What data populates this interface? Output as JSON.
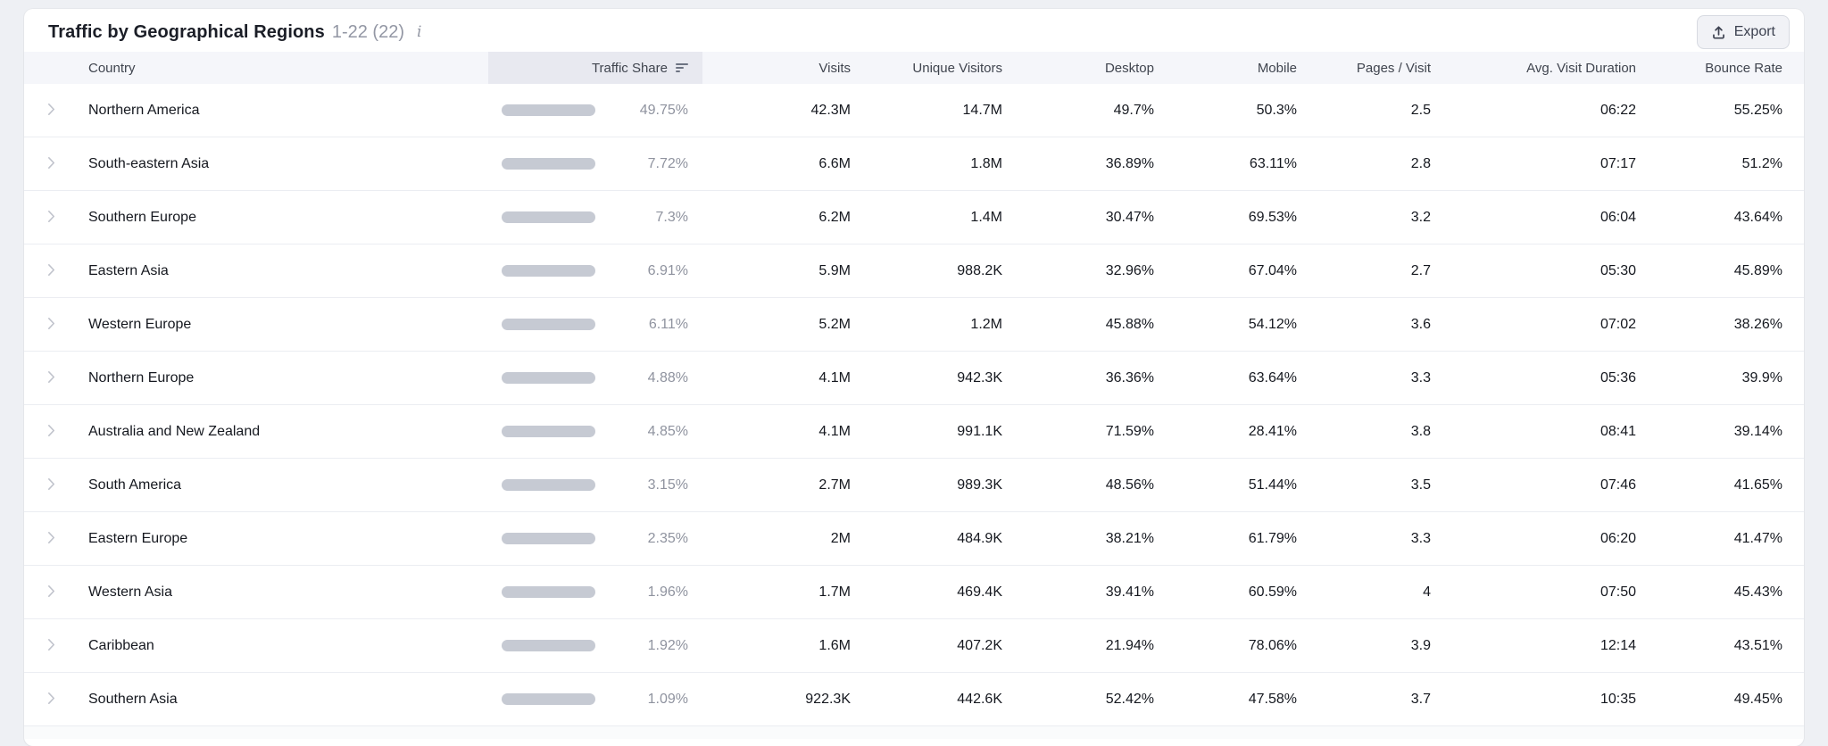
{
  "panel": {
    "title": "Traffic by Geographical Regions",
    "range_label": "1-22 (22)",
    "info_icon_glyph": "i",
    "export_label": "Export"
  },
  "colors": {
    "bar_fill": "#39a9f4",
    "bar_track": "#c6cad3",
    "header_highlight": "#e8e9f0",
    "page_background": "#eef0f4"
  },
  "table": {
    "columns": [
      "Country",
      "Traffic Share",
      "Visits",
      "Unique Visitors",
      "Desktop",
      "Mobile",
      "Pages / Visit",
      "Avg. Visit Duration",
      "Bounce Rate"
    ],
    "sorted_column": "Traffic Share",
    "rows": [
      {
        "country": "Northern America",
        "traffic_share_pct": 49.75,
        "traffic_share_label": "49.75%",
        "visits": "42.3M",
        "unique_visitors": "14.7M",
        "desktop": "49.7%",
        "mobile": "50.3%",
        "pages_per_visit": "2.5",
        "avg_visit_duration": "06:22",
        "bounce_rate": "55.25%"
      },
      {
        "country": "South-eastern Asia",
        "traffic_share_pct": 7.72,
        "traffic_share_label": "7.72%",
        "visits": "6.6M",
        "unique_visitors": "1.8M",
        "desktop": "36.89%",
        "mobile": "63.11%",
        "pages_per_visit": "2.8",
        "avg_visit_duration": "07:17",
        "bounce_rate": "51.2%"
      },
      {
        "country": "Southern Europe",
        "traffic_share_pct": 7.3,
        "traffic_share_label": "7.3%",
        "visits": "6.2M",
        "unique_visitors": "1.4M",
        "desktop": "30.47%",
        "mobile": "69.53%",
        "pages_per_visit": "3.2",
        "avg_visit_duration": "06:04",
        "bounce_rate": "43.64%"
      },
      {
        "country": "Eastern Asia",
        "traffic_share_pct": 6.91,
        "traffic_share_label": "6.91%",
        "visits": "5.9M",
        "unique_visitors": "988.2K",
        "desktop": "32.96%",
        "mobile": "67.04%",
        "pages_per_visit": "2.7",
        "avg_visit_duration": "05:30",
        "bounce_rate": "45.89%"
      },
      {
        "country": "Western Europe",
        "traffic_share_pct": 6.11,
        "traffic_share_label": "6.11%",
        "visits": "5.2M",
        "unique_visitors": "1.2M",
        "desktop": "45.88%",
        "mobile": "54.12%",
        "pages_per_visit": "3.6",
        "avg_visit_duration": "07:02",
        "bounce_rate": "38.26%"
      },
      {
        "country": "Northern Europe",
        "traffic_share_pct": 4.88,
        "traffic_share_label": "4.88%",
        "visits": "4.1M",
        "unique_visitors": "942.3K",
        "desktop": "36.36%",
        "mobile": "63.64%",
        "pages_per_visit": "3.3",
        "avg_visit_duration": "05:36",
        "bounce_rate": "39.9%"
      },
      {
        "country": "Australia and New Zealand",
        "traffic_share_pct": 4.85,
        "traffic_share_label": "4.85%",
        "visits": "4.1M",
        "unique_visitors": "991.1K",
        "desktop": "71.59%",
        "mobile": "28.41%",
        "pages_per_visit": "3.8",
        "avg_visit_duration": "08:41",
        "bounce_rate": "39.14%"
      },
      {
        "country": "South America",
        "traffic_share_pct": 3.15,
        "traffic_share_label": "3.15%",
        "visits": "2.7M",
        "unique_visitors": "989.3K",
        "desktop": "48.56%",
        "mobile": "51.44%",
        "pages_per_visit": "3.5",
        "avg_visit_duration": "07:46",
        "bounce_rate": "41.65%"
      },
      {
        "country": "Eastern Europe",
        "traffic_share_pct": 2.35,
        "traffic_share_label": "2.35%",
        "visits": "2M",
        "unique_visitors": "484.9K",
        "desktop": "38.21%",
        "mobile": "61.79%",
        "pages_per_visit": "3.3",
        "avg_visit_duration": "06:20",
        "bounce_rate": "41.47%"
      },
      {
        "country": "Western Asia",
        "traffic_share_pct": 1.96,
        "traffic_share_label": "1.96%",
        "visits": "1.7M",
        "unique_visitors": "469.4K",
        "desktop": "39.41%",
        "mobile": "60.59%",
        "pages_per_visit": "4",
        "avg_visit_duration": "07:50",
        "bounce_rate": "45.43%"
      },
      {
        "country": "Caribbean",
        "traffic_share_pct": 1.92,
        "traffic_share_label": "1.92%",
        "visits": "1.6M",
        "unique_visitors": "407.2K",
        "desktop": "21.94%",
        "mobile": "78.06%",
        "pages_per_visit": "3.9",
        "avg_visit_duration": "12:14",
        "bounce_rate": "43.51%"
      },
      {
        "country": "Southern Asia",
        "traffic_share_pct": 1.09,
        "traffic_share_label": "1.09%",
        "visits": "922.3K",
        "unique_visitors": "442.6K",
        "desktop": "52.42%",
        "mobile": "47.58%",
        "pages_per_visit": "3.7",
        "avg_visit_duration": "10:35",
        "bounce_rate": "49.45%"
      }
    ]
  }
}
